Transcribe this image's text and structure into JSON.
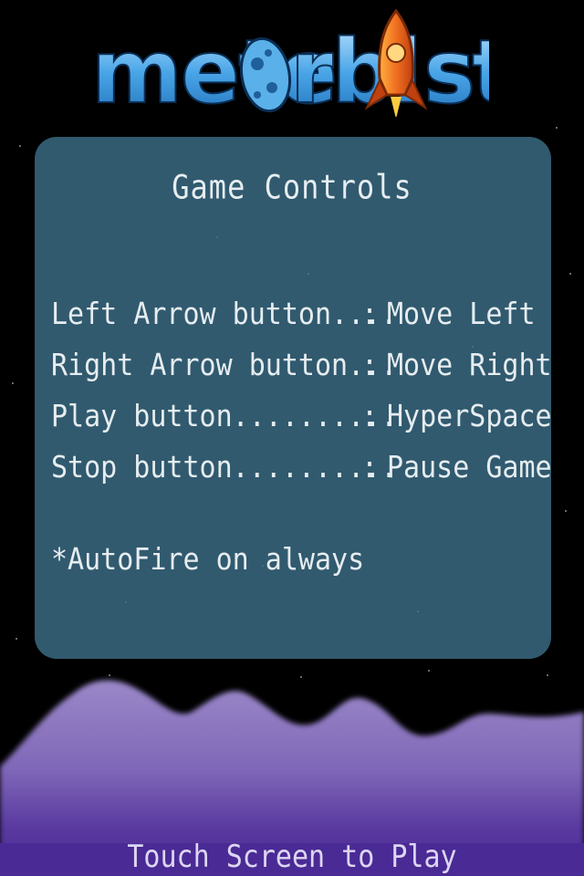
{
  "logo": {
    "text_before": "mete",
    "text_after": "rbl",
    "text_end": "st"
  },
  "panel": {
    "title": "Game Controls",
    "controls": [
      {
        "key": "Left Arrow button....",
        "sep": ":",
        "action": "Move Left"
      },
      {
        "key": "Right Arrow button...",
        "sep": ":",
        "action": "Move Right"
      },
      {
        "key": "Play button..........",
        "sep": ":",
        "action": "HyperSpace"
      },
      {
        "key": "Stop button..........",
        "sep": ":",
        "action": "Pause Game"
      }
    ],
    "note": "*AutoFire on always"
  },
  "footer": {
    "prompt": "Touch Screen to Play"
  },
  "colors": {
    "background": "#000000",
    "panel": "#315a6f",
    "panel_text": "#e6edf0",
    "logo_blue": "#4aa6e8",
    "terrain_light": "#8c78c0",
    "terrain_dark": "#4a2a94",
    "rocket": "#f07020"
  },
  "icons": {
    "meteor": "meteor-icon",
    "rocket": "rocket-icon"
  }
}
